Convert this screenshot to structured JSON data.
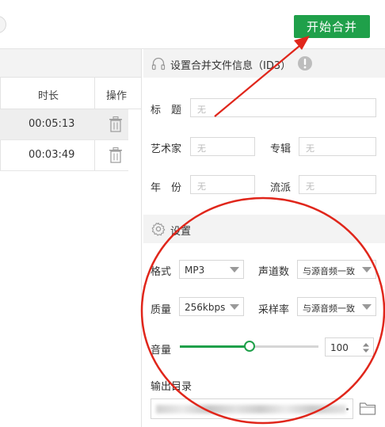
{
  "toolbar": {
    "merge_label": "开始合并"
  },
  "table": {
    "col_duration": "时长",
    "col_action": "操作",
    "rows": [
      {
        "duration": "00:05:13",
        "selected": true
      },
      {
        "duration": "00:03:49",
        "selected": false
      }
    ]
  },
  "info": {
    "title": "设置合并文件信息（ID3）",
    "title_label": "标　题",
    "title_placeholder": "无",
    "artist_label": "艺术家",
    "artist_placeholder": "无",
    "album_label": "专辑",
    "album_placeholder": "无",
    "year_label": "年　份",
    "year_placeholder": "无",
    "genre_label": "流派",
    "genre_placeholder": "无"
  },
  "settings": {
    "title": "设置",
    "format_label": "格式",
    "format_value": "MP3",
    "channels_label": "声道数",
    "channels_value": "与源音频一致",
    "quality_label": "质量",
    "quality_value": "256kbps",
    "samplerate_label": "采样率",
    "samplerate_value": "与源音频一致",
    "volume_label": "音量",
    "volume_value": "100",
    "volume_level": 0.5,
    "output_label": "输出目录"
  },
  "colors": {
    "accent_green": "#1fa04a",
    "annotation_red": "#e0261b"
  }
}
